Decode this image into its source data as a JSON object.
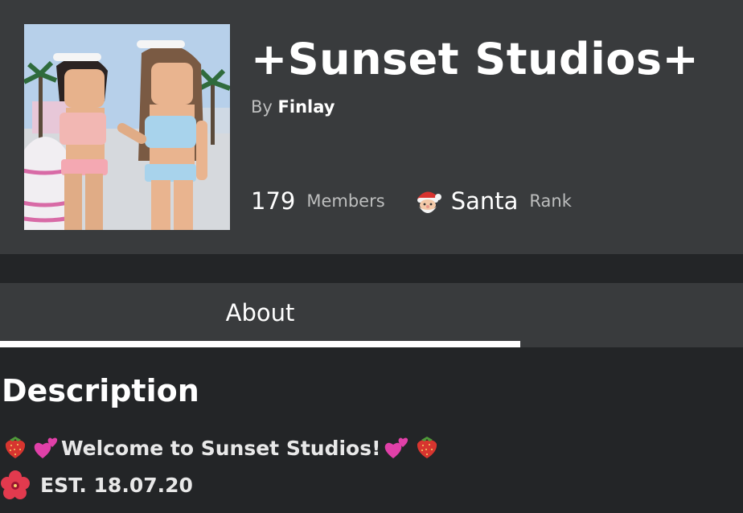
{
  "group": {
    "name": "+Sunset Studios+",
    "by_label": "By",
    "owner": "Finlay",
    "members_count": "179",
    "members_label": "Members",
    "rank_name": "Santa",
    "rank_label": "Rank",
    "rank_icon": "santa-icon",
    "thumbnail": "group-thumbnail"
  },
  "tabs": [
    {
      "label": "About",
      "selected": true
    }
  ],
  "description": {
    "heading": "Description",
    "line1": "Welcome to Sunset Studios!",
    "line2": "EST. 18.07.20",
    "line1_icons": [
      "strawberry-icon",
      "two-hearts-icon",
      "two-hearts-icon",
      "strawberry-icon"
    ],
    "line2_icons": [
      "hibiscus-icon"
    ]
  },
  "colors": {
    "page_bg": "#232527",
    "header_bg": "#393b3d",
    "text_primary": "#ffffff",
    "text_secondary": "#bdbebe",
    "tab_underline": "#ffffff"
  }
}
